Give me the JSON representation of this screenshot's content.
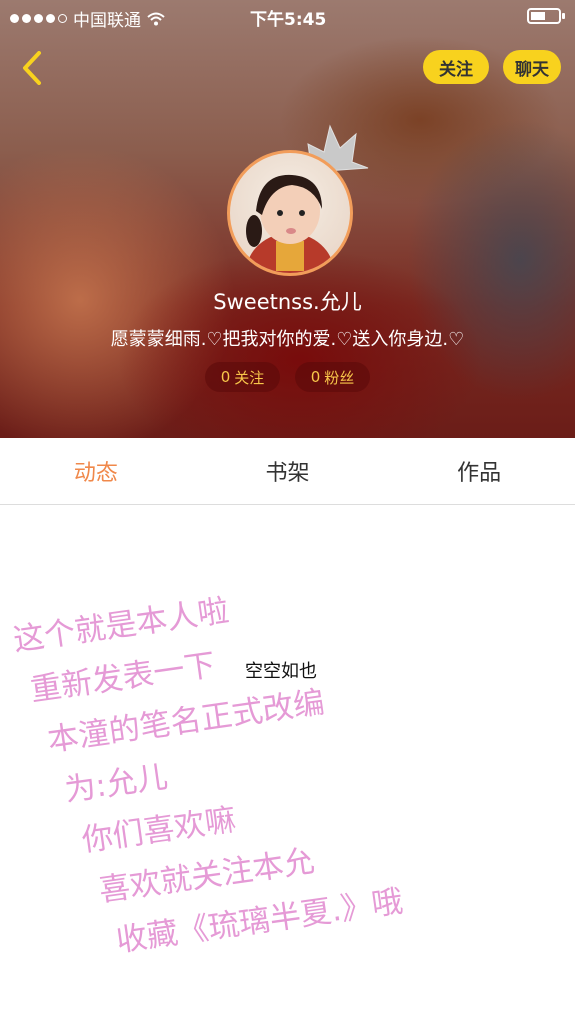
{
  "status_bar": {
    "carrier": "中国联通",
    "time": "下午5:45"
  },
  "header": {
    "follow_label": "关注",
    "chat_label": "聊天",
    "username": "Sweetnss.允儿",
    "bio": "愿蒙蒙细雨.♡把我对你的爱.♡送入你身边.♡",
    "stats": {
      "following_count": "0",
      "following_label": "关注",
      "fans_count": "0",
      "fans_label": "粉丝"
    }
  },
  "tabs": [
    {
      "label": "动态"
    },
    {
      "label": "书架"
    },
    {
      "label": "作品"
    }
  ],
  "content": {
    "empty_text": "空空如也",
    "note_lines": [
      "这个就是本人啦",
      "重新发表一下",
      "本潼的笔名正式改编",
      "为:允儿",
      "你们喜欢嘛",
      "喜欢就关注本允",
      "收藏《琉璃半夏.》哦"
    ]
  },
  "colors": {
    "accent": "#f0884a",
    "button_yellow": "#f8d21e",
    "stat_text": "#f8c64a",
    "note_pink": "#e59ad6"
  }
}
